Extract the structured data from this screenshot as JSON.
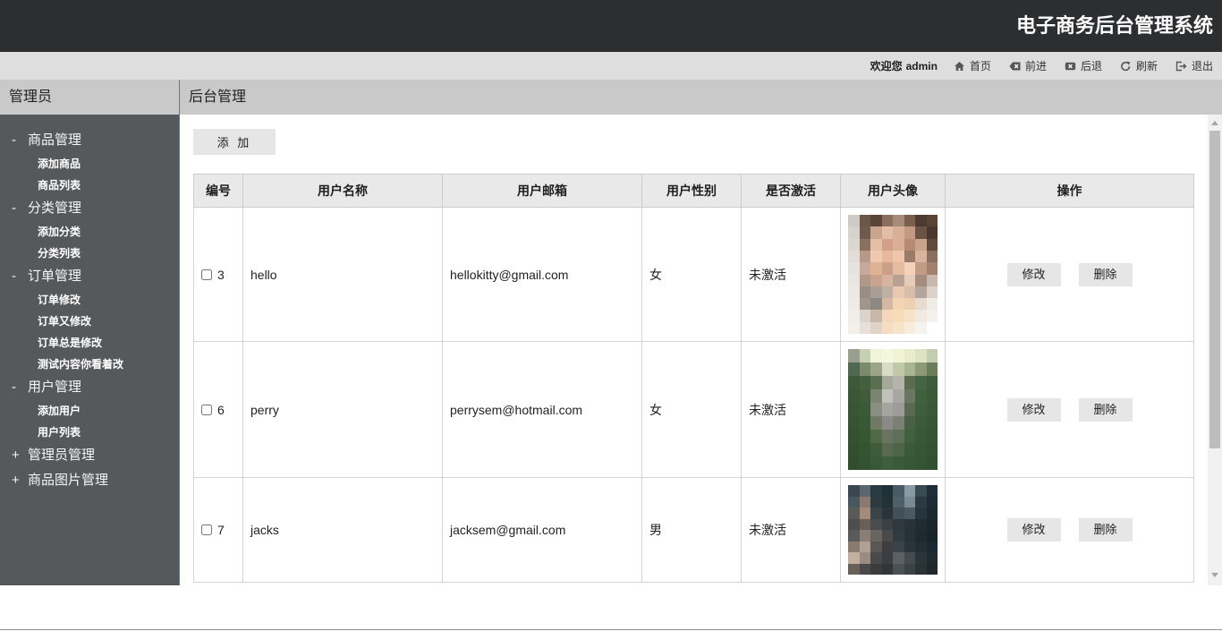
{
  "header": {
    "title": "电子商务后台管理系统"
  },
  "topbar": {
    "welcome": "欢迎您",
    "username": "admin",
    "links": [
      {
        "icon": "home-icon",
        "label": "首页"
      },
      {
        "icon": "backspace-icon",
        "label": "前进"
      },
      {
        "icon": "close-box-icon",
        "label": "后退"
      },
      {
        "icon": "refresh-icon",
        "label": "刷新"
      },
      {
        "icon": "logout-icon",
        "label": "退出"
      }
    ]
  },
  "sidebar": {
    "title": "管理员",
    "groups": [
      {
        "toggle": "-",
        "label": "商品管理",
        "items": [
          "添加商品",
          "商品列表"
        ]
      },
      {
        "toggle": "-",
        "label": "分类管理",
        "items": [
          "添加分类",
          "分类列表"
        ]
      },
      {
        "toggle": "-",
        "label": "订单管理",
        "items": [
          "订单修改",
          "订单又修改",
          "订单总是修改",
          "测试内容你看着改"
        ]
      },
      {
        "toggle": "-",
        "label": "用户管理",
        "items": [
          "添加用户",
          "用户列表"
        ]
      },
      {
        "toggle": "+",
        "label": "管理员管理",
        "items": []
      },
      {
        "toggle": "+",
        "label": "商品图片管理",
        "items": []
      }
    ]
  },
  "main": {
    "title": "后台管理",
    "add_button": "添 加",
    "table": {
      "columns": [
        "编号",
        "用户名称",
        "用户邮箱",
        "用户性别",
        "是否激活",
        "用户头像",
        "操作"
      ],
      "rows": [
        {
          "id": "3",
          "name": "hello",
          "email": "hellokitty@gmail.com",
          "gender": "女",
          "status": "未激活",
          "selected": false
        },
        {
          "id": "6",
          "name": "perry",
          "email": "perrysem@hotmail.com",
          "gender": "女",
          "status": "未激活",
          "selected": false
        },
        {
          "id": "7",
          "name": "jacks",
          "email": "jacksem@gmail.com",
          "gender": "男",
          "status": "未激活",
          "selected": false
        }
      ],
      "edit_label": "修改",
      "delete_label": "删除"
    }
  },
  "colors": {
    "header_bg": "#2d2e30",
    "topbar_bg": "#dedede",
    "panel_head_bg": "#c9c9c9",
    "sidebar_bg": "#56595c",
    "divider": "#3f7ed6",
    "table_head_bg": "#e9e9e9",
    "button_bg": "#e6e6e6"
  }
}
